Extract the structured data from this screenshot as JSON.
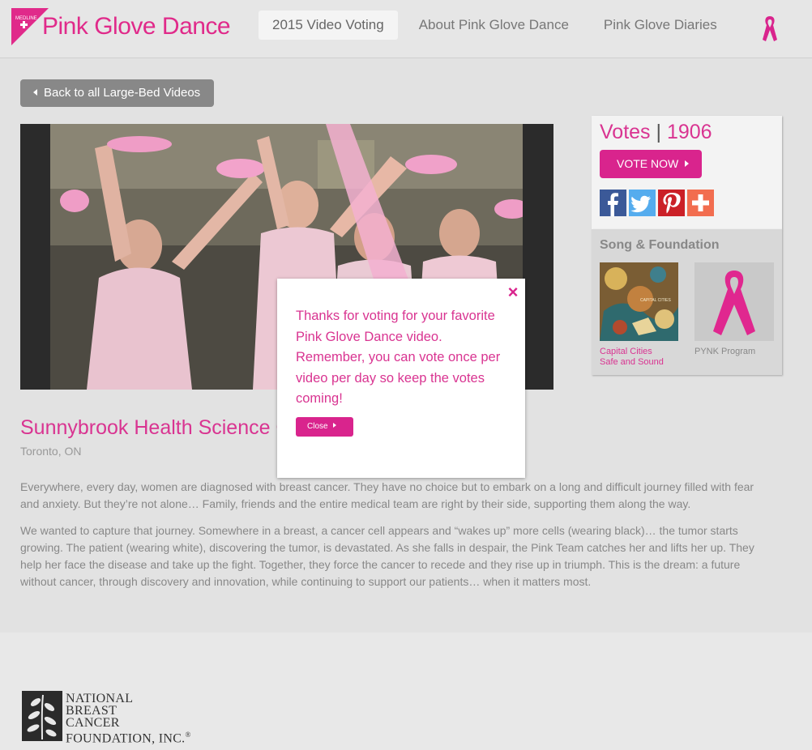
{
  "header": {
    "brand": "Pink Glove Dance",
    "brand_small": "MEDLINE",
    "nav": [
      {
        "label": "2015 Video Voting",
        "active": true
      },
      {
        "label": "About Pink Glove Dance",
        "active": false
      },
      {
        "label": "Pink Glove Diaries",
        "active": false
      }
    ],
    "ribbon_icon": "pink-ribbon-icon"
  },
  "back_button": {
    "label": "Back to all Large-Bed Videos"
  },
  "video": {
    "content": "pink-glove-dancers-still"
  },
  "entry": {
    "title": "Sunnybrook Health Science C",
    "location": "Toronto, ON",
    "description": [
      "Everywhere, every day, women are diagnosed with breast cancer.   They have no choice but to embark on a long and difficult journey filled with fear and anxiety.  But they’re not alone… Family, friends and the entire medical team are right by their side, supporting them along the way.",
      "We wanted to capture that journey.  Somewhere in a breast, a cancer cell appears and “wakes up” more cells (wearing black)… the tumor starts growing. The patient (wearing white),  discovering the tumor,  is devastated. As she falls in despair, the Pink Team catches her and lifts her up.  They help her face the disease and take up the fight.  Together, they force the cancer to recede and they rise up in triumph.  This is the dream: a future without cancer, through discovery and innovation, while continuing to support our patients… when it matters most."
    ]
  },
  "votes": {
    "label": "Votes",
    "separator": "|",
    "count": "1906",
    "vote_button": "VOTE NOW"
  },
  "social": [
    {
      "name": "facebook",
      "color": "#3b5998"
    },
    {
      "name": "twitter",
      "color": "#55acee"
    },
    {
      "name": "pinterest",
      "color": "#cb2027"
    },
    {
      "name": "addthis",
      "color": "#f26d4f"
    }
  ],
  "song_foundation": {
    "title": "Song & Foundation",
    "song_line1": "Capital Cities",
    "song_line2": "Safe and Sound",
    "album_art_text": "CAPITAL CITIES",
    "foundation": "PYNK Program"
  },
  "footer": {
    "logo_lines": [
      "NATIONAL",
      "BREAST",
      "CANCER",
      "FOUNDATION, INC."
    ],
    "logo_mark": "®"
  },
  "modal": {
    "message": "Thanks for voting for your favorite Pink Glove Dance video. Remember, you can vote once per video per day so keep the votes coming!",
    "close_label": "Close",
    "close_icon": "×"
  },
  "colors": {
    "brand_pink": "#d9248d",
    "title_pink": "#d93491",
    "page_bg": "#e2e2e2"
  }
}
